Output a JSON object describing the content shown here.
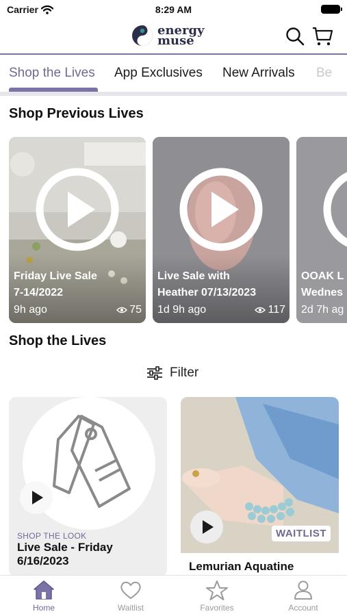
{
  "status_bar": {
    "carrier": "Carrier",
    "time": "8:29 AM"
  },
  "header": {
    "logo_line1": "energy",
    "logo_line2": "muse"
  },
  "tabs": [
    {
      "label": "Shop the Lives",
      "active": true
    },
    {
      "label": "App Exclusives",
      "active": false
    },
    {
      "label": "New Arrivals",
      "active": false
    },
    {
      "label": "Be",
      "active": false
    }
  ],
  "sections": {
    "previous": "Shop Previous Lives",
    "lives": "Shop the Lives"
  },
  "previous_lives": [
    {
      "title_line1": "Friday Live Sale",
      "title_line2": "7-14/2022",
      "ago": "9h ago",
      "views": "75"
    },
    {
      "title_line1": "Live Sale with",
      "title_line2": "Heather 07/13/2023",
      "ago": "1d 9h ago",
      "views": "117"
    },
    {
      "title_line1": "OOAK L",
      "title_line2": "Wednes",
      "ago": "2d 7h ag",
      "views": ""
    }
  ],
  "filter_label": "Filter",
  "cards": [
    {
      "eyebrow": "SHOP THE LOOK",
      "title": "Live Sale - Friday 6/16/2023"
    },
    {
      "badge": "WAITLIST",
      "title": "Lemurian Aquatine"
    }
  ],
  "bottom_nav": [
    {
      "label": "Home",
      "icon": "home-icon",
      "active": true
    },
    {
      "label": "Waitlist",
      "icon": "heart-icon",
      "active": false
    },
    {
      "label": "Favorites",
      "icon": "star-icon",
      "active": false
    },
    {
      "label": "Account",
      "icon": "person-icon",
      "active": false
    }
  ],
  "colors": {
    "accent": "#7b73a6",
    "brand": "#2b2f4a"
  }
}
